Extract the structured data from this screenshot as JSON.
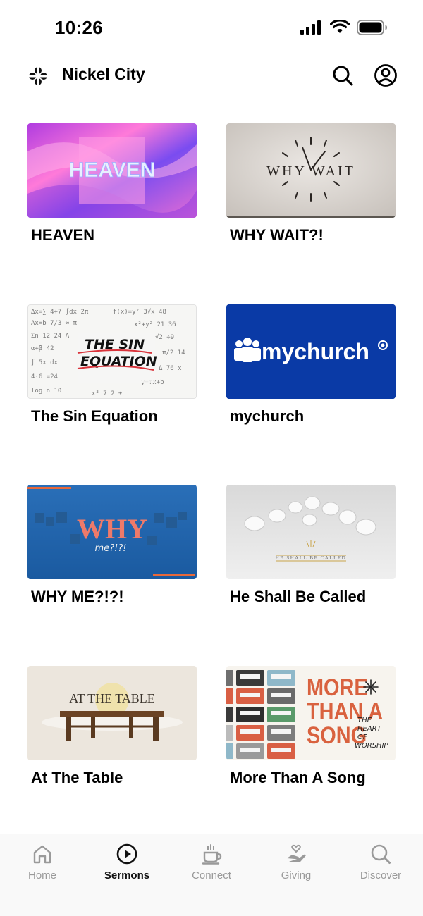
{
  "status_bar": {
    "time": "10:26"
  },
  "header": {
    "church_name": "Nickel City"
  },
  "sermons": [
    {
      "title": "HEAVEN",
      "thumb_text": "HEAVEN"
    },
    {
      "title": "WHY WAIT?!",
      "thumb_text": "WHY WAIT"
    },
    {
      "title": "The Sin Equation",
      "thumb_text": "THE SIN EQUATION"
    },
    {
      "title": "mychurch",
      "thumb_text": "mychurch"
    },
    {
      "title": "WHY ME?!?!",
      "thumb_text": "WHY",
      "thumb_subtext": "me?!?!"
    },
    {
      "title": "He Shall Be Called",
      "thumb_text": "HE SHALL BE CALLED"
    },
    {
      "title": "At The Table",
      "thumb_text": "AT THE TABLE"
    },
    {
      "title": "More Than A Song",
      "thumb_text": "MORE THAN A SONG",
      "thumb_subtext": "THE HEART OF WORSHIP"
    }
  ],
  "tabs": [
    {
      "label": "Home",
      "icon": "home-icon",
      "active": false
    },
    {
      "label": "Sermons",
      "icon": "play-circle-icon",
      "active": true
    },
    {
      "label": "Connect",
      "icon": "coffee-cup-icon",
      "active": false
    },
    {
      "label": "Giving",
      "icon": "heart-hand-icon",
      "active": false
    },
    {
      "label": "Discover",
      "icon": "search-icon",
      "active": false
    }
  ],
  "colors": {
    "mychurch_blue": "#0a3aa6",
    "tab_inactive": "#9a9a9a",
    "tab_active": "#111111"
  }
}
